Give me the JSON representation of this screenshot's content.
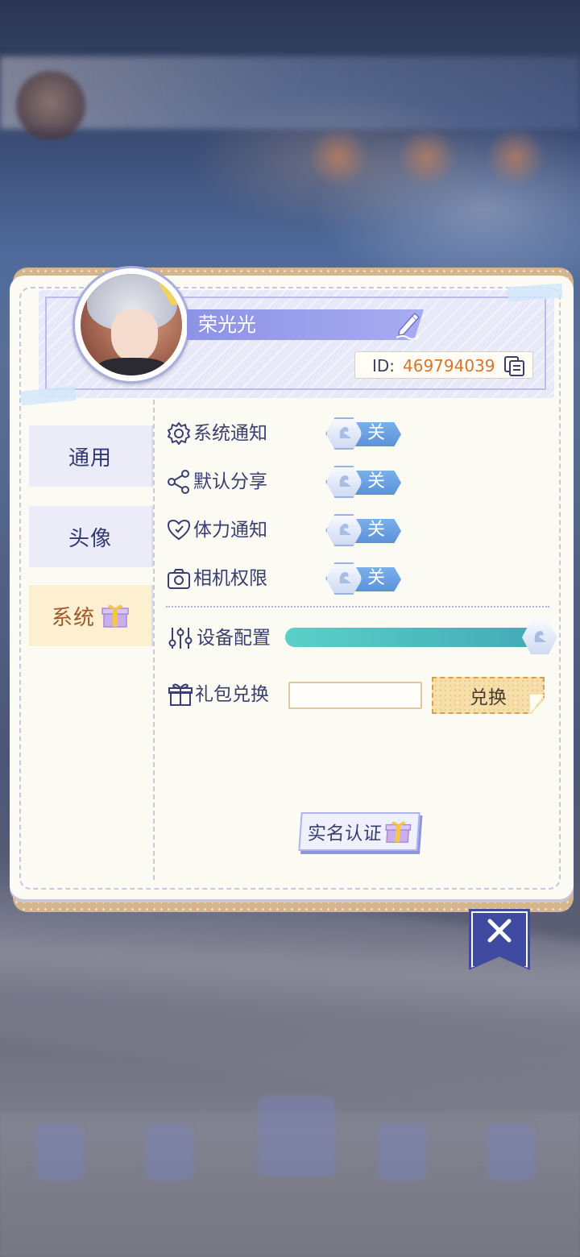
{
  "profile": {
    "name": "荣光光",
    "id_label": "ID:",
    "id_value": "469794039"
  },
  "tabs": [
    {
      "label": "通用",
      "active": false
    },
    {
      "label": "头像",
      "active": false
    },
    {
      "label": "系统",
      "active": true
    }
  ],
  "settings": {
    "toggles": [
      {
        "label": "系统通知",
        "icon": "gear-icon",
        "state": "关"
      },
      {
        "label": "默认分享",
        "icon": "share-icon",
        "state": "关"
      },
      {
        "label": "体力通知",
        "icon": "heart-icon",
        "state": "关"
      },
      {
        "label": "相机权限",
        "icon": "camera-icon",
        "state": "关"
      }
    ],
    "device_config": {
      "label": "设备配置",
      "icon": "sliders-icon",
      "level": 1.0
    },
    "gift_code": {
      "label": "礼包兑换",
      "icon": "gift-icon",
      "value": "",
      "placeholder": "",
      "button": "兑换"
    }
  },
  "realname_button": "实名认证",
  "close_button": "close-icon",
  "colors": {
    "accent": "#8d93e5",
    "id_value": "#d8742c",
    "active_tab_bg": "#fcf0d0",
    "toggle_blue": "#5a92da",
    "slider_teal": "#43a9b6",
    "close_bg": "#3f4aa1"
  }
}
